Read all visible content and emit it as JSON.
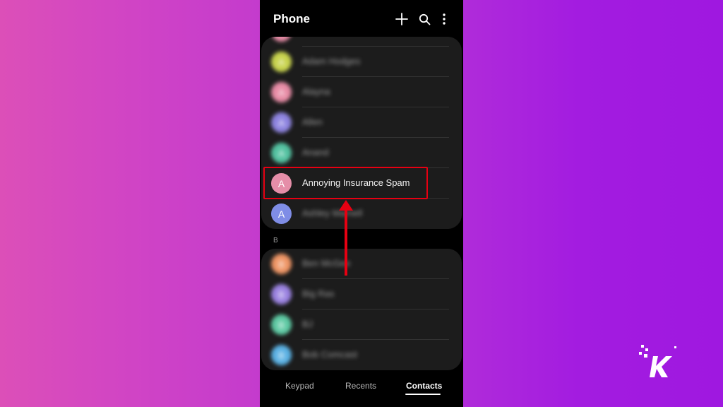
{
  "colors": {
    "accent_annotation": "#e60012",
    "screen_background": "#000000",
    "card_background": "#1c1c1c"
  },
  "header": {
    "title": "Phone",
    "icons": [
      "plus-icon",
      "search-icon",
      "more-vertical-icon"
    ]
  },
  "contacts": {
    "group_a": [
      {
        "name": "Adam Hodges",
        "initial": "A",
        "avatar_color": "#c8d34e",
        "blurred": true
      },
      {
        "name": "Alayna",
        "initial": "A",
        "avatar_color": "#e88ca6",
        "blurred": true
      },
      {
        "name": "Allen",
        "initial": "A",
        "avatar_color": "#8e84e0",
        "blurred": true
      },
      {
        "name": "Anand",
        "initial": "A",
        "avatar_color": "#54c2a1",
        "blurred": true
      },
      {
        "name": "Annoying Insurance Spam",
        "initial": "A",
        "avatar_color": "#e58ea8",
        "blurred": false
      },
      {
        "name": "Ashley Marnell",
        "initial": "A",
        "avatar_color": "#7f8de6",
        "blurred": true
      }
    ],
    "section_b_letter": "B",
    "group_b": [
      {
        "name": "Ben McGee",
        "initial": "B",
        "avatar_color": "#ee9565",
        "blurred": true
      },
      {
        "name": "Big Ras",
        "initial": "B",
        "avatar_color": "#9a82e0",
        "blurred": true
      },
      {
        "name": "BJ",
        "initial": "B",
        "avatar_color": "#5ec9a3",
        "blurred": true
      },
      {
        "name": "Bob Comcast",
        "initial": "B",
        "avatar_color": "#5bb1e3",
        "blurred": true
      }
    ]
  },
  "bottom_nav": {
    "tabs": [
      {
        "label": "Keypad",
        "active": false
      },
      {
        "label": "Recents",
        "active": false
      },
      {
        "label": "Contacts",
        "active": true
      }
    ]
  },
  "annotation": {
    "highlighted_contact": "Annoying Insurance Spam",
    "arrow_direction": "up"
  }
}
